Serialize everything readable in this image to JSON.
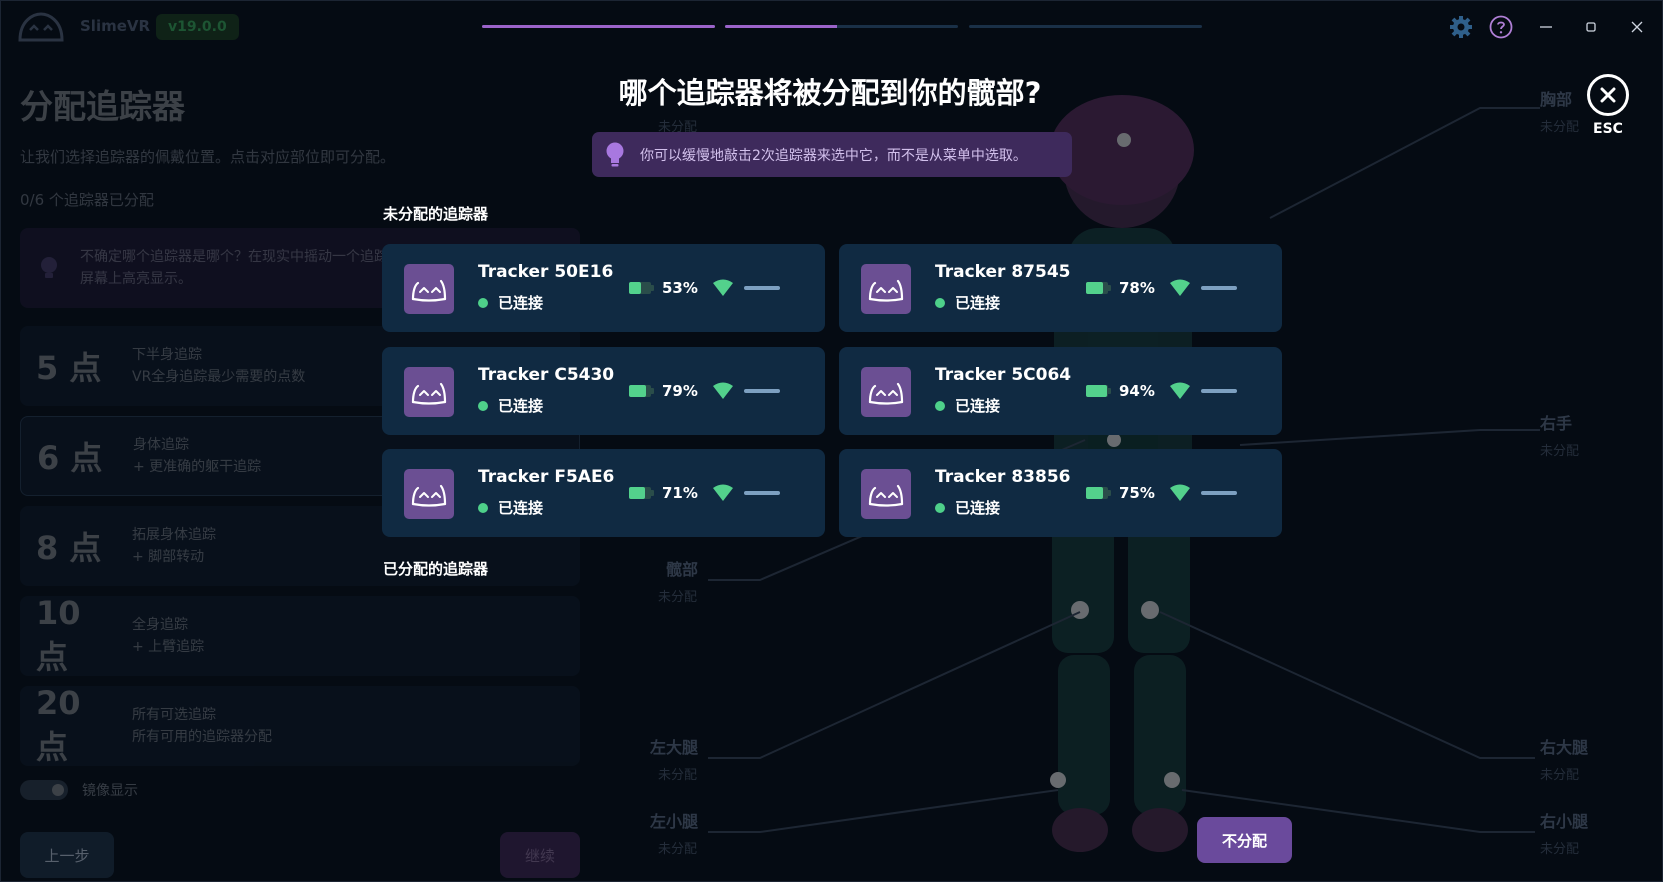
{
  "app": {
    "name": "SlimeVR",
    "version": "v19.0.0"
  },
  "background": {
    "title": "分配追踪器",
    "description": "让我们选择追踪器的佩戴位置。点击对应部位即可分配。",
    "count": "0/6 个追踪器已分配",
    "tip_line1": "不确定哪个追踪器是哪个？在现实中摇动一个追踪器，对应的那个将在",
    "tip_line2": "屏幕上高亮显示。",
    "options": [
      {
        "points": "5 点",
        "title": "下半身追踪",
        "desc": "VR全身追踪最少需要的点数"
      },
      {
        "points": "6 点",
        "title": "身体追踪",
        "desc": "+ 更准确的躯干追踪"
      },
      {
        "points": "8 点",
        "title": "拓展身体追踪",
        "desc": "+ 脚部转动"
      },
      {
        "points": "10 点",
        "title": "全身追踪",
        "desc": "+ 上臂追踪"
      },
      {
        "points": "20 点",
        "title": "所有可选追踪",
        "desc": "所有可用的追踪器分配"
      }
    ],
    "mirror_label": "镜像显示",
    "prev_button": "上一步",
    "next_button": "继续",
    "body_parts": {
      "chest": "胸部",
      "right_hand": "右手",
      "hip": "髋部",
      "left_upper_leg": "左大腿",
      "right_upper_leg": "右大腿",
      "left_lower_leg": "左小腿",
      "right_lower_leg": "右小腿",
      "unassigned": "未分配"
    }
  },
  "modal": {
    "title": "哪个追踪器将被分配到你的髋部?",
    "tip": "你可以缓慢地敲击2次追踪器来选中它，而不是从菜单中选取。",
    "esc_label": "ESC",
    "unassigned_section": "未分配的追踪器",
    "assigned_section": "已分配的追踪器",
    "unassign_button": "不分配",
    "trackers": [
      {
        "name": "Tracker 50E16",
        "status": "已连接",
        "battery": "53%",
        "battery_level": 0.53
      },
      {
        "name": "Tracker 87545",
        "status": "已连接",
        "battery": "78%",
        "battery_level": 0.78
      },
      {
        "name": "Tracker C5430",
        "status": "已连接",
        "battery": "79%",
        "battery_level": 0.79
      },
      {
        "name": "Tracker 5C064",
        "status": "已连接",
        "battery": "94%",
        "battery_level": 0.94
      },
      {
        "name": "Tracker F5AE6",
        "status": "已连接",
        "battery": "71%",
        "battery_level": 0.71
      },
      {
        "name": "Tracker 83856",
        "status": "已连接",
        "battery": "75%",
        "battery_level": 0.75
      }
    ]
  },
  "colors": {
    "accent": "#6a4a9c",
    "card": "#102a42",
    "connected": "#4ed08a",
    "battery": "#53d18c"
  }
}
